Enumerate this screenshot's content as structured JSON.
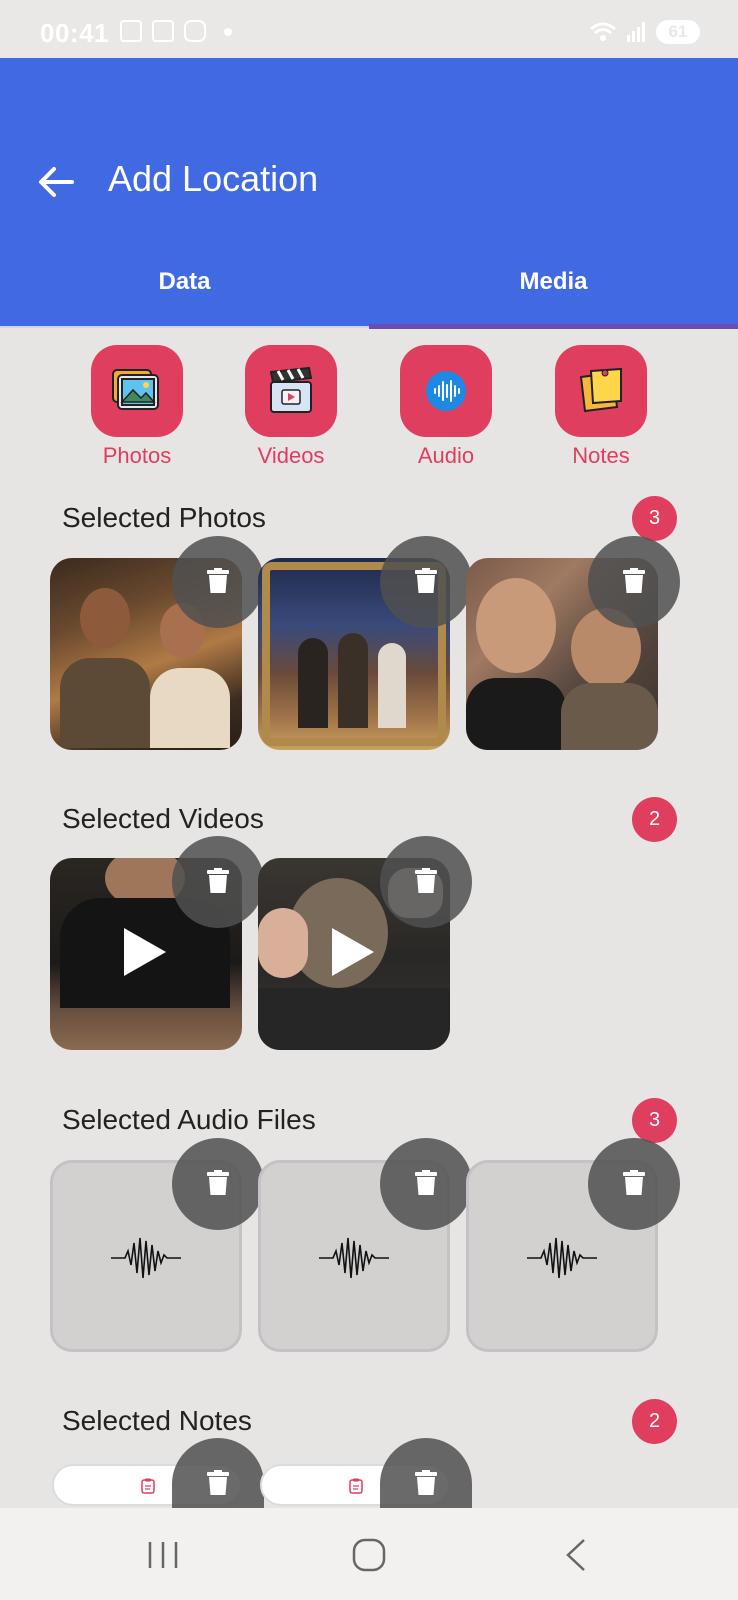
{
  "status_bar": {
    "time": "00:41",
    "battery": "61"
  },
  "header": {
    "title": "Add Location",
    "back_icon": "arrow-left-icon"
  },
  "tabs": [
    {
      "label": "Data"
    },
    {
      "label": "Media"
    }
  ],
  "colors": {
    "primary": "#4169e1",
    "accent": "#e03e5e",
    "indicator": "#6a4bb8",
    "background": "#e7e5e4"
  },
  "categories": [
    {
      "label": "Photos",
      "icon": "photos-icon"
    },
    {
      "label": "Videos",
      "icon": "clapperboard-icon"
    },
    {
      "label": "Audio",
      "icon": "audio-wave-icon"
    },
    {
      "label": "Notes",
      "icon": "sticky-note-icon"
    }
  ],
  "sections": {
    "photos": {
      "title": "Selected Photos",
      "count": "3"
    },
    "videos": {
      "title": "Selected Videos",
      "count": "2"
    },
    "audio": {
      "title": "Selected Audio Files",
      "count": "3"
    },
    "notes": {
      "title": "Selected Notes",
      "count": "2"
    }
  }
}
